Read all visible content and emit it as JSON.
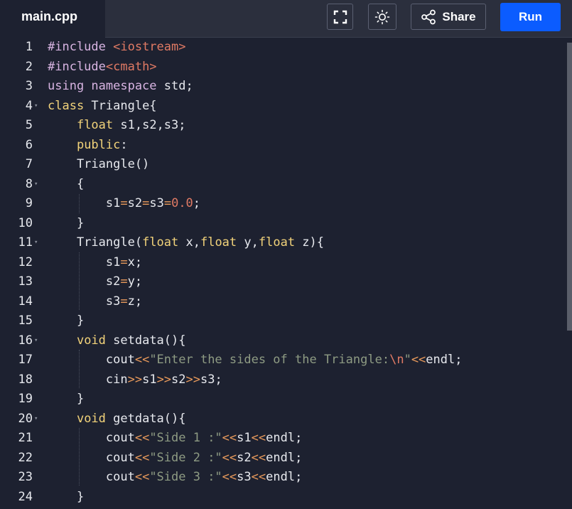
{
  "tab": {
    "filename": "main.cpp"
  },
  "toolbar": {
    "fullscreen_icon": "fullscreen-icon",
    "theme_icon": "sun-icon",
    "share_icon": "share-icon",
    "share_label": "Share",
    "run_label": "Run"
  },
  "colors": {
    "background": "#1d2130",
    "topbar": "#2b2f3d",
    "run_button": "#0b5cff",
    "keyword": "#f2d37a",
    "string": "#8e9b83",
    "number": "#e07a64",
    "operator": "#e99a5b"
  },
  "editor": {
    "lines": [
      {
        "num": "1",
        "fold": false,
        "tokens": [
          [
            "pre",
            "#include "
          ],
          [
            "inc",
            "<iostream>"
          ]
        ]
      },
      {
        "num": "2",
        "fold": false,
        "tokens": [
          [
            "pre",
            "#include"
          ],
          [
            "inc",
            "<cmath>"
          ]
        ]
      },
      {
        "num": "3",
        "fold": false,
        "tokens": [
          [
            "pre",
            "using namespace "
          ],
          [
            "id",
            "std;"
          ]
        ]
      },
      {
        "num": "4",
        "fold": true,
        "tokens": [
          [
            "kw",
            "class "
          ],
          [
            "id",
            "Triangle{"
          ]
        ]
      },
      {
        "num": "5",
        "fold": false,
        "tokens": [
          [
            "id",
            "    "
          ],
          [
            "kw",
            "float "
          ],
          [
            "id",
            "s1,s2,s3;"
          ]
        ]
      },
      {
        "num": "6",
        "fold": false,
        "tokens": [
          [
            "id",
            "    "
          ],
          [
            "kw",
            "public"
          ],
          [
            "id",
            ":"
          ]
        ]
      },
      {
        "num": "7",
        "fold": false,
        "tokens": [
          [
            "id",
            "    Triangle()"
          ]
        ]
      },
      {
        "num": "8",
        "fold": true,
        "tokens": [
          [
            "id",
            "    {"
          ]
        ]
      },
      {
        "num": "9",
        "fold": false,
        "tokens": [
          [
            "id",
            "        s1"
          ],
          [
            "op",
            "="
          ],
          [
            "id",
            "s2"
          ],
          [
            "op",
            "="
          ],
          [
            "id",
            "s3"
          ],
          [
            "op",
            "="
          ],
          [
            "num",
            "0.0"
          ],
          [
            "id",
            ";"
          ]
        ]
      },
      {
        "num": "10",
        "fold": false,
        "tokens": [
          [
            "id",
            "    }"
          ]
        ]
      },
      {
        "num": "11",
        "fold": true,
        "tokens": [
          [
            "id",
            "    Triangle("
          ],
          [
            "kw",
            "float "
          ],
          [
            "id",
            "x,"
          ],
          [
            "kw",
            "float "
          ],
          [
            "id",
            "y,"
          ],
          [
            "kw",
            "float "
          ],
          [
            "id",
            "z){"
          ]
        ]
      },
      {
        "num": "12",
        "fold": false,
        "tokens": [
          [
            "id",
            "        s1"
          ],
          [
            "op",
            "="
          ],
          [
            "id",
            "x;"
          ]
        ]
      },
      {
        "num": "13",
        "fold": false,
        "tokens": [
          [
            "id",
            "        s2"
          ],
          [
            "op",
            "="
          ],
          [
            "id",
            "y;"
          ]
        ]
      },
      {
        "num": "14",
        "fold": false,
        "tokens": [
          [
            "id",
            "        s3"
          ],
          [
            "op",
            "="
          ],
          [
            "id",
            "z;"
          ]
        ]
      },
      {
        "num": "15",
        "fold": false,
        "tokens": [
          [
            "id",
            "    }"
          ]
        ]
      },
      {
        "num": "16",
        "fold": true,
        "tokens": [
          [
            "id",
            "    "
          ],
          [
            "kw",
            "void "
          ],
          [
            "id",
            "setdata(){"
          ]
        ]
      },
      {
        "num": "17",
        "fold": false,
        "tokens": [
          [
            "id",
            "        cout"
          ],
          [
            "op",
            "<<"
          ],
          [
            "str",
            "\"Enter the sides of the Triangle:"
          ],
          [
            "esc",
            "\\n"
          ],
          [
            "str",
            "\""
          ],
          [
            "op",
            "<<"
          ],
          [
            "id",
            "endl;"
          ]
        ]
      },
      {
        "num": "18",
        "fold": false,
        "tokens": [
          [
            "id",
            "        cin"
          ],
          [
            "op",
            ">>"
          ],
          [
            "id",
            "s1"
          ],
          [
            "op",
            ">>"
          ],
          [
            "id",
            "s2"
          ],
          [
            "op",
            ">>"
          ],
          [
            "id",
            "s3;"
          ]
        ]
      },
      {
        "num": "19",
        "fold": false,
        "tokens": [
          [
            "id",
            "    }"
          ]
        ]
      },
      {
        "num": "20",
        "fold": true,
        "tokens": [
          [
            "id",
            "    "
          ],
          [
            "kw",
            "void "
          ],
          [
            "id",
            "getdata(){"
          ]
        ]
      },
      {
        "num": "21",
        "fold": false,
        "tokens": [
          [
            "id",
            "        cout"
          ],
          [
            "op",
            "<<"
          ],
          [
            "str",
            "\"Side 1 :\""
          ],
          [
            "op",
            "<<"
          ],
          [
            "id",
            "s1"
          ],
          [
            "op",
            "<<"
          ],
          [
            "id",
            "endl;"
          ]
        ]
      },
      {
        "num": "22",
        "fold": false,
        "tokens": [
          [
            "id",
            "        cout"
          ],
          [
            "op",
            "<<"
          ],
          [
            "str",
            "\"Side 2 :\""
          ],
          [
            "op",
            "<<"
          ],
          [
            "id",
            "s2"
          ],
          [
            "op",
            "<<"
          ],
          [
            "id",
            "endl;"
          ]
        ]
      },
      {
        "num": "23",
        "fold": false,
        "tokens": [
          [
            "id",
            "        cout"
          ],
          [
            "op",
            "<<"
          ],
          [
            "str",
            "\"Side 3 :\""
          ],
          [
            "op",
            "<<"
          ],
          [
            "id",
            "s3"
          ],
          [
            "op",
            "<<"
          ],
          [
            "id",
            "endl;"
          ]
        ]
      },
      {
        "num": "24",
        "fold": false,
        "tokens": [
          [
            "id",
            "    }"
          ]
        ]
      }
    ]
  }
}
